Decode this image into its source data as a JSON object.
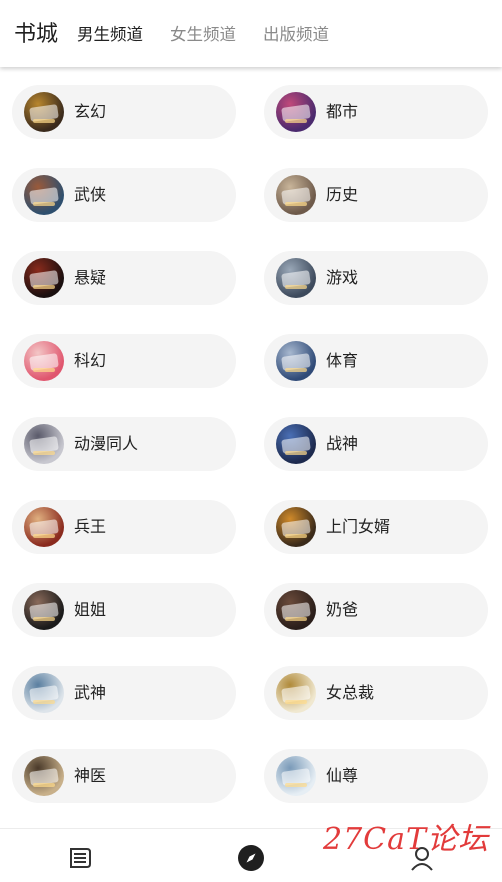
{
  "header": {
    "title": "书城",
    "tabs": [
      {
        "label": "男生频道",
        "active": true
      },
      {
        "label": "女生频道",
        "active": false
      },
      {
        "label": "出版频道",
        "active": false
      }
    ]
  },
  "categories": [
    {
      "label": "玄幻",
      "cover_colors": [
        "#3a2a1c",
        "#b8862e"
      ]
    },
    {
      "label": "都市",
      "cover_colors": [
        "#4b2a6e",
        "#c0497a"
      ]
    },
    {
      "label": "武侠",
      "cover_colors": [
        "#2e4f6e",
        "#9a5a3a"
      ]
    },
    {
      "label": "历史",
      "cover_colors": [
        "#6e5a4a",
        "#c9b59a"
      ]
    },
    {
      "label": "悬疑",
      "cover_colors": [
        "#1a0f0f",
        "#8a2b1c"
      ]
    },
    {
      "label": "游戏",
      "cover_colors": [
        "#3d4a5c",
        "#9aa8b8"
      ]
    },
    {
      "label": "科幻",
      "cover_colors": [
        "#e0566e",
        "#f3c6c6"
      ]
    },
    {
      "label": "体育",
      "cover_colors": [
        "#2f4a77",
        "#a7b8cf"
      ]
    },
    {
      "label": "动漫同人",
      "cover_colors": [
        "#c7c7cf",
        "#5a5a6a"
      ]
    },
    {
      "label": "战神",
      "cover_colors": [
        "#1d2a4e",
        "#4a6fb5"
      ]
    },
    {
      "label": "兵王",
      "cover_colors": [
        "#8a2a1e",
        "#e0b080"
      ]
    },
    {
      "label": "上门女婿",
      "cover_colors": [
        "#3a2a1a",
        "#d08a2a"
      ]
    },
    {
      "label": "姐姐",
      "cover_colors": [
        "#1a1a1a",
        "#8a6a5a"
      ]
    },
    {
      "label": "奶爸",
      "cover_colors": [
        "#2a1e1a",
        "#6a4a3a"
      ]
    },
    {
      "label": "武神",
      "cover_colors": [
        "#dde4ea",
        "#5a7fa0"
      ]
    },
    {
      "label": "女总裁",
      "cover_colors": [
        "#f0e8d0",
        "#b08a3a"
      ]
    },
    {
      "label": "神医",
      "cover_colors": [
        "#c8b08a",
        "#4a3a2a"
      ]
    },
    {
      "label": "仙尊",
      "cover_colors": [
        "#e6eef4",
        "#7a9ab8"
      ]
    }
  ],
  "bottom_nav": {
    "items": [
      {
        "icon": "bookshelf-icon",
        "active": false
      },
      {
        "icon": "compass-icon",
        "active": true
      },
      {
        "icon": "user-icon",
        "active": false
      }
    ]
  },
  "watermark": "27CaT论坛",
  "colors": {
    "pill_bg": "#f4f4f4",
    "text": "#222222",
    "inactive_tab": "#8a8a8a",
    "watermark": "#e23b3b"
  }
}
